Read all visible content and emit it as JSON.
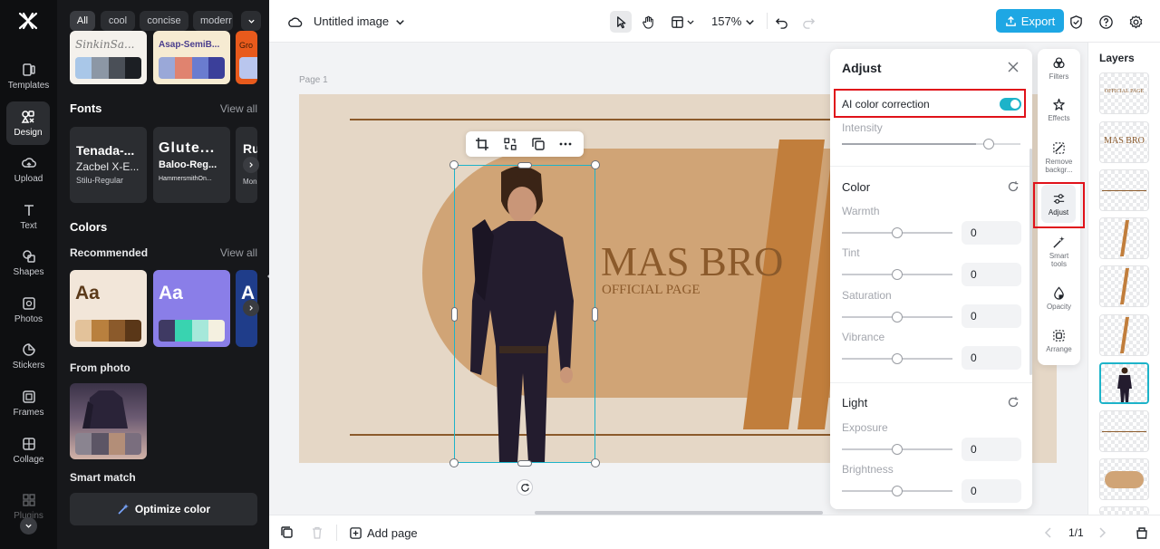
{
  "rail": {
    "items": [
      {
        "label": "Templates",
        "icon": "templates-icon"
      },
      {
        "label": "Design",
        "icon": "design-icon"
      },
      {
        "label": "Upload",
        "icon": "upload-icon"
      },
      {
        "label": "Text",
        "icon": "text-icon"
      },
      {
        "label": "Shapes",
        "icon": "shapes-icon"
      },
      {
        "label": "Photos",
        "icon": "photos-icon"
      },
      {
        "label": "Stickers",
        "icon": "stickers-icon"
      },
      {
        "label": "Frames",
        "icon": "frames-icon"
      },
      {
        "label": "Collage",
        "icon": "collage-icon"
      },
      {
        "label": "Plugins",
        "icon": "plugins-icon"
      }
    ]
  },
  "panel": {
    "chips": [
      "All",
      "cool",
      "concise",
      "moderr"
    ],
    "palette_names": [
      "SinkinSa...",
      "Asap-SemiB...",
      "Gro"
    ],
    "fonts_title": "Fonts",
    "fonts_view_all": "View all",
    "fonts": [
      {
        "l1": "Tenada-...",
        "l2": "Zacbel X-E...",
        "l3": "Stilu-Regular"
      },
      {
        "l1": "Glute...",
        "l2": "Baloo-Reg...",
        "l3": "HammersmithOn..."
      },
      {
        "l1": "Ru",
        "l2": "",
        "l3": "Mon"
      }
    ],
    "colors_title": "Colors",
    "recommended": "Recommended",
    "colors_view_all": "View all",
    "aa": "Aa",
    "aa2": "Aa",
    "aa3": "A",
    "from_photo": "From photo",
    "smart_match": "Smart match",
    "optimize": "Optimize color"
  },
  "topbar": {
    "title": "Untitled image",
    "zoom": "157%",
    "export": "Export"
  },
  "canvas": {
    "page_label": "Page 1",
    "headline": "MAS BRO",
    "subline": "OFFICIAL PAGE"
  },
  "adjust": {
    "title": "Adjust",
    "ai_color": "AI color correction",
    "intensity": "Intensity",
    "color_section": "Color",
    "warmth": "Warmth",
    "warmth_val": "0",
    "tint": "Tint",
    "tint_val": "0",
    "saturation": "Saturation",
    "saturation_val": "0",
    "vibrance": "Vibrance",
    "vibrance_val": "0",
    "light_section": "Light",
    "exposure": "Exposure",
    "exposure_val": "0",
    "brightness": "Brightness",
    "brightness_val": "0",
    "intensity_level": 0.8,
    "toggle_on": true
  },
  "rtools": {
    "filters": "Filters",
    "effects": "Effects",
    "remove_bg_1": "Remove",
    "remove_bg_2": "backgr...",
    "adjust": "Adjust",
    "smart_1": "Smart",
    "smart_2": "tools",
    "opacity": "Opacity",
    "arrange": "Arrange"
  },
  "layers": {
    "title": "Layers",
    "t1": "OFFICIAL PAGE",
    "t2": "MAS BRO"
  },
  "bottombar": {
    "add_page": "Add page",
    "pages": "1/1"
  },
  "colors": {
    "accent": "#1db3c9",
    "export_bg": "#1ea7e4",
    "highlight": "#e0121a",
    "brown": "#c17e3c"
  }
}
